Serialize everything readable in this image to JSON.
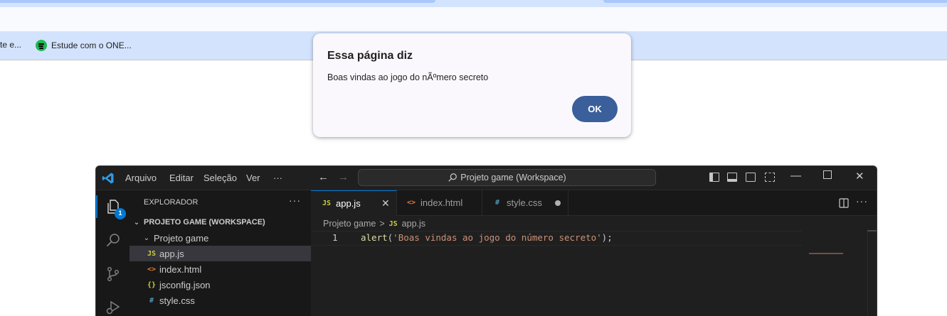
{
  "browser": {
    "bookmarks": [
      {
        "label": "te e..."
      },
      {
        "label": "Estude com o ONE..."
      }
    ]
  },
  "alert": {
    "title": "Essa página diz",
    "message": "Boas vindas ao jogo do nÃºmero secreto",
    "ok_label": "OK",
    "ok_color": "#3a5f9a"
  },
  "vscode": {
    "menu": [
      "Arquivo",
      "Editar",
      "Seleção",
      "Ver",
      "···"
    ],
    "command_center": "Projeto game (Workspace)",
    "activity_badge": "1",
    "explorer": {
      "title": "EXPLORADOR",
      "more": "···",
      "workspace": "PROJETO GAME (WORKSPACE)",
      "folder": "Projeto game",
      "files": [
        {
          "name": "app.js",
          "icon_text": "JS",
          "icon_color": "#cbcb41",
          "selected": true
        },
        {
          "name": "index.html",
          "icon_text": "<>",
          "icon_color": "#e37933",
          "selected": false
        },
        {
          "name": "jsconfig.json",
          "icon_text": "{}",
          "icon_color": "#cbcb41",
          "selected": false
        },
        {
          "name": "style.css",
          "icon_text": "#",
          "icon_color": "#519aba",
          "selected": false
        }
      ]
    },
    "tabs": [
      {
        "label": "app.js",
        "icon_text": "JS",
        "active": true
      },
      {
        "label": "index.html",
        "icon_text": "<>",
        "active": false
      },
      {
        "label": "style.css",
        "icon_text": "#",
        "active": false,
        "modified": true
      }
    ],
    "breadcrumb": {
      "folder": "Projeto game",
      "separator": ">",
      "file_icon": "JS",
      "file": "app.js"
    },
    "code": {
      "line_number": "1",
      "fn": "alert",
      "open": "(",
      "string": "'Boas vindas ao jogo do número secreto'",
      "close": ");"
    },
    "accent_color": "#0078d4"
  }
}
